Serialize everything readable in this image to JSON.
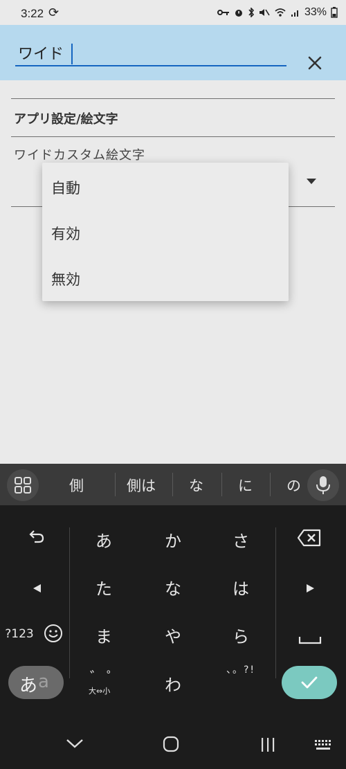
{
  "status_bar": {
    "time": "3:22",
    "battery": "33%",
    "icons": [
      "sync-icon",
      "key-icon",
      "alarm-icon",
      "bluetooth-icon",
      "mute-icon",
      "wifi-icon",
      "signal-icon",
      "battery-icon"
    ]
  },
  "search": {
    "value": "ワイド",
    "clear_icon": "close-icon"
  },
  "settings": {
    "category": "アプリ設定/絵文字",
    "pref_title": "ワイドカスタム絵文字"
  },
  "dropdown": {
    "options": [
      "自動",
      "有効",
      "無効"
    ]
  },
  "keyboard": {
    "suggestions": [
      "側",
      "側は",
      "な",
      "に",
      "の"
    ],
    "rows": [
      [
        "あ",
        "か",
        "さ"
      ],
      [
        "た",
        "な",
        "は"
      ],
      [
        "ま",
        "や",
        "ら"
      ],
      [
        "゛゜",
        "わ",
        "、。?!"
      ]
    ],
    "sym_label": "?123",
    "size_label": "大⇔小",
    "toggle_primary": "あ",
    "toggle_secondary": "a",
    "accent_color": "#7bc9c0"
  },
  "colors": {
    "search_bar": "#b6d9ee",
    "underline": "#1565c0"
  }
}
